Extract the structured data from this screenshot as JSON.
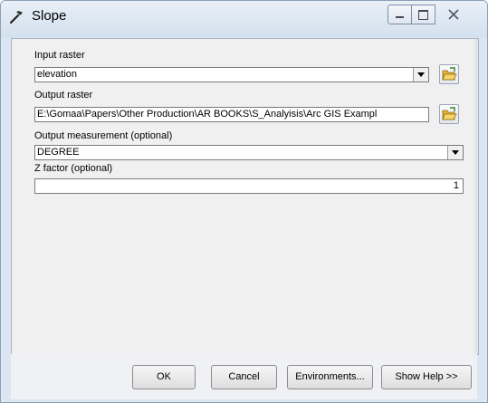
{
  "window": {
    "title": "Slope",
    "title_icon": "slope-tool-icon",
    "controls": [
      "minimize-icon",
      "maximize-icon",
      "close-icon"
    ]
  },
  "form": {
    "input_raster": {
      "label": "Input raster",
      "value": "elevation",
      "browse_icon": "open-folder-icon"
    },
    "output_raster": {
      "label": "Output raster",
      "value": "E:\\Gomaa\\Papers\\Other Production\\AR BOOKS\\S_Analyisis\\Arc GIS Exampl",
      "browse_icon": "open-folder-icon"
    },
    "output_measurement": {
      "label": "Output measurement (optional)",
      "value": "DEGREE"
    },
    "z_factor": {
      "label": "Z factor (optional)",
      "value": "1"
    }
  },
  "buttons": {
    "ok": "OK",
    "cancel": "Cancel",
    "environments": "Environments...",
    "show_help": "Show Help >>"
  }
}
